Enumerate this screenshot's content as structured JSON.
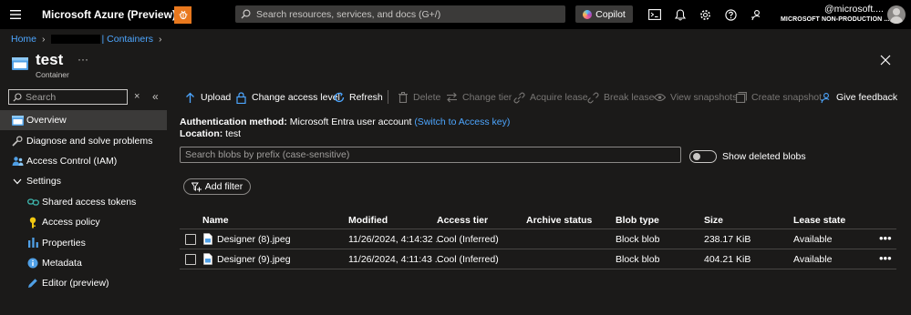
{
  "topbar": {
    "app_title": "Microsoft Azure (Preview)",
    "search_placeholder": "Search resources, services, and docs (G+/)",
    "copilot_label": "Copilot",
    "account_email_suffix": "@microsoft....",
    "account_directory": "MICROSOFT NON-PRODUCTION ..."
  },
  "breadcrumb": {
    "home": "Home",
    "containers_suffix": "| Containers"
  },
  "resource": {
    "title": "test",
    "subtitle": "Container",
    "more": "···"
  },
  "sidebar": {
    "search_placeholder": "Search",
    "clear": "×",
    "collapse": "«",
    "items": [
      {
        "label": "Overview",
        "icon": "container-icon"
      },
      {
        "label": "Diagnose and solve problems",
        "icon": "wrench-icon"
      },
      {
        "label": "Access Control (IAM)",
        "icon": "people-icon"
      },
      {
        "label": "Settings",
        "icon": "chevron-down-icon"
      },
      {
        "label": "Shared access tokens",
        "icon": "link-icon"
      },
      {
        "label": "Access policy",
        "icon": "key-icon"
      },
      {
        "label": "Properties",
        "icon": "bars-icon"
      },
      {
        "label": "Metadata",
        "icon": "info-icon"
      },
      {
        "label": "Editor (preview)",
        "icon": "pencil-icon"
      }
    ]
  },
  "commands": {
    "upload": "Upload",
    "change_access_level": "Change access level",
    "refresh": "Refresh",
    "delete": "Delete",
    "change_tier": "Change tier",
    "acquire_lease": "Acquire lease",
    "break_lease": "Break lease",
    "view_snapshots": "View snapshots",
    "create_snapshot": "Create snapshot",
    "give_feedback": "Give feedback"
  },
  "info": {
    "auth_label": "Authentication method:",
    "auth_value": "Microsoft Entra user account",
    "auth_link": "(Switch to Access key)",
    "location_label": "Location:",
    "location_value": "test"
  },
  "filters": {
    "blob_search_placeholder": "Search blobs by prefix (case-sensitive)",
    "show_deleted_label": "Show deleted blobs",
    "show_deleted_on": false,
    "add_filter": "Add filter"
  },
  "table": {
    "columns": [
      "Name",
      "Modified",
      "Access tier",
      "Archive status",
      "Blob type",
      "Size",
      "Lease state"
    ],
    "rows": [
      {
        "name": "Designer (8).jpeg",
        "modified": "11/26/2024, 4:14:32 ...",
        "tier": "Cool (Inferred)",
        "archive": "",
        "blob_type": "Block blob",
        "size": "238.17 KiB",
        "lease": "Available",
        "more": "•••"
      },
      {
        "name": "Designer (9).jpeg",
        "modified": "11/26/2024, 4:11:43 ...",
        "tier": "Cool (Inferred)",
        "archive": "",
        "blob_type": "Block blob",
        "size": "404.21 KiB",
        "lease": "Available",
        "more": "•••"
      }
    ]
  },
  "colors": {
    "background": "#1b1a19",
    "topbar": "#000000",
    "accent_link": "#4da6ff",
    "icon_blue": "#50a0e6",
    "bug_orange": "#e8781e"
  }
}
